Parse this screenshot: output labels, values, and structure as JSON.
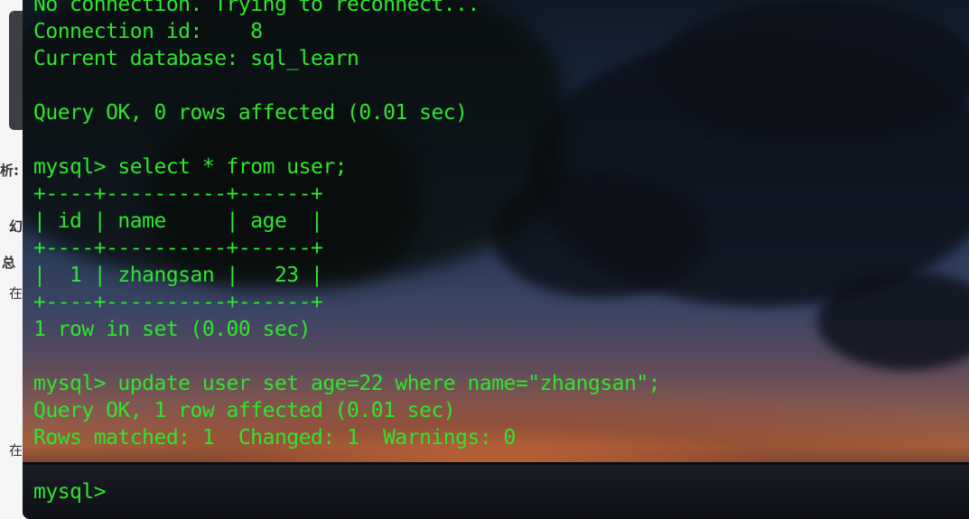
{
  "background_page": {
    "labels": [
      "析:",
      "幻",
      "总",
      "在",
      "在"
    ]
  },
  "terminal": {
    "lines": [
      "No connection. Trying to reconnect...",
      "Connection id:    8",
      "Current database: sql_learn",
      "",
      "Query OK, 0 rows affected (0.01 sec)",
      "",
      "mysql> select * from user;",
      "+----+----------+------+",
      "| id | name     | age  |",
      "+----+----------+------+",
      "|  1 | zhangsan |   23 |",
      "+----+----------+------+",
      "1 row in set (0.00 sec)",
      "",
      "mysql> update user set age=22 where name=\"zhangsan\";",
      "Query OK, 1 row affected (0.01 sec)",
      "Rows matched: 1  Changed: 1  Warnings: 0",
      "",
      "mysql>"
    ],
    "text_color": "#2ee62e"
  }
}
